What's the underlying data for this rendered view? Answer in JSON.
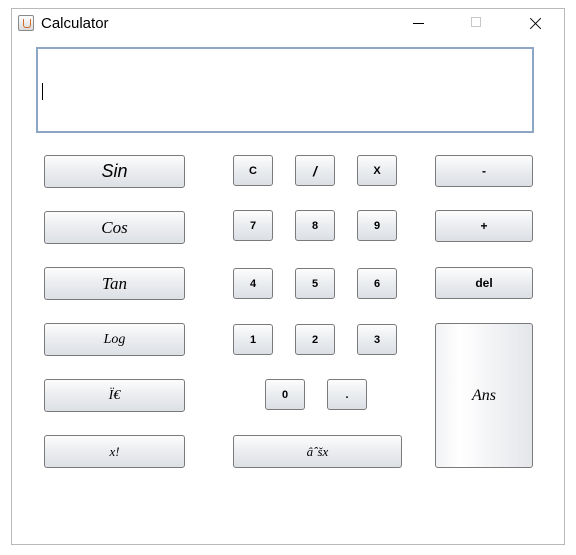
{
  "window": {
    "title": "Calculator",
    "controls": {
      "minimize": "minimize",
      "maximize": "maximize",
      "close": "close"
    }
  },
  "display": {
    "value": ""
  },
  "functions": {
    "sin": "Sin",
    "cos": "Cos",
    "tan": "Tan",
    "log": "Log",
    "pi": "Ï€",
    "factorial": "x!"
  },
  "keypad": {
    "clear": "C",
    "divide": "/",
    "multiply": "X",
    "seven": "7",
    "eight": "8",
    "nine": "9",
    "four": "4",
    "five": "5",
    "six": "6",
    "one": "1",
    "two": "2",
    "three": "3",
    "zero": "0",
    "dot": ".",
    "sqrt": "âˆšx"
  },
  "operators": {
    "minus": "-",
    "plus": "+",
    "delete": "del",
    "answer": "Ans"
  }
}
